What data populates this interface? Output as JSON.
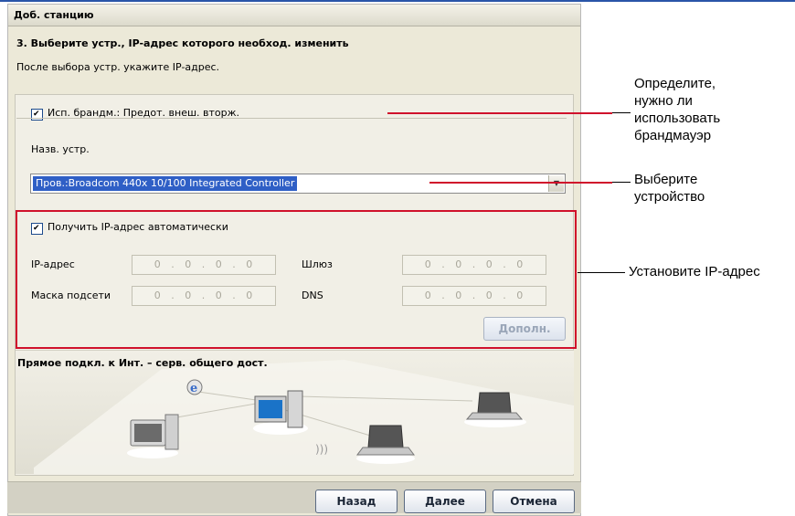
{
  "dialog": {
    "title": "Доб. станцию",
    "step_title": "3. Выберите устр., IP-адрес которого необход. изменить",
    "step_desc": "После выбора устр. укажите IP-адрес."
  },
  "firewall": {
    "checked": true,
    "label": "Исп. брандм.: Предот. внеш. вторж."
  },
  "device": {
    "label": "Назв. устр.",
    "selected": "Пров.:Broadcom 440x 10/100 Integrated Controller"
  },
  "ip": {
    "auto_checked": true,
    "auto_label": "Получить IP-адрес автоматически",
    "ip_label": "IP-адрес",
    "ip_value": "0 . 0 . 0 . 0",
    "gateway_label": "Шлюз",
    "gateway_value": "0 . 0 . 0 . 0",
    "mask_label": "Маска подсети",
    "mask_value": "0 . 0 . 0 . 0",
    "dns_label": "DNS",
    "dns_value": "0 . 0 . 0 . 0",
    "advanced_button": "Дополн."
  },
  "illustration": {
    "caption": "Прямое подкл. к Инт. – серв. общего дост."
  },
  "nav": {
    "back": "Назад",
    "next": "Далее",
    "cancel": "Отмена"
  },
  "annotations": {
    "firewall": [
      "Определите,",
      "нужно ли",
      "использовать",
      "брандмауэр"
    ],
    "device": [
      "Выберите",
      "устройство"
    ],
    "ip": "Установите IP-адрес"
  },
  "colors": {
    "highlight_red": "#d0112b",
    "selection_blue": "#2f5fc6"
  }
}
